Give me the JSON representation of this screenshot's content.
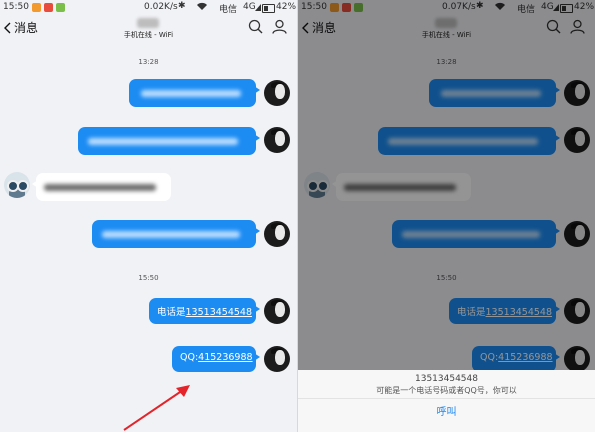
{
  "status_bar": {
    "time": "15:50",
    "carrier": "电信",
    "network": "4G",
    "battery": "42%",
    "speed_left": "0.02K/s",
    "speed_right": "0.07K/s"
  },
  "header": {
    "back_label": "消息",
    "contact_status": "手机在线 - WiFi"
  },
  "chat": {
    "timestamps": [
      "13:28",
      "15:50"
    ],
    "phone_prefix": "电话是",
    "phone_number": "13513454548",
    "qq_prefix": "QQ:",
    "qq_number": "415236988"
  },
  "action_sheet": {
    "number": "13513454548",
    "hint": "可能是一个电话号码或者QQ号，你可以",
    "call_label": "呼叫"
  },
  "colors": {
    "bubble_out": "#1c8cf3",
    "bubble_in": "#ffffff",
    "background": "#f1f2f6",
    "link_accent": "#1b87f0",
    "annotation_arrow": "#e3242b"
  }
}
